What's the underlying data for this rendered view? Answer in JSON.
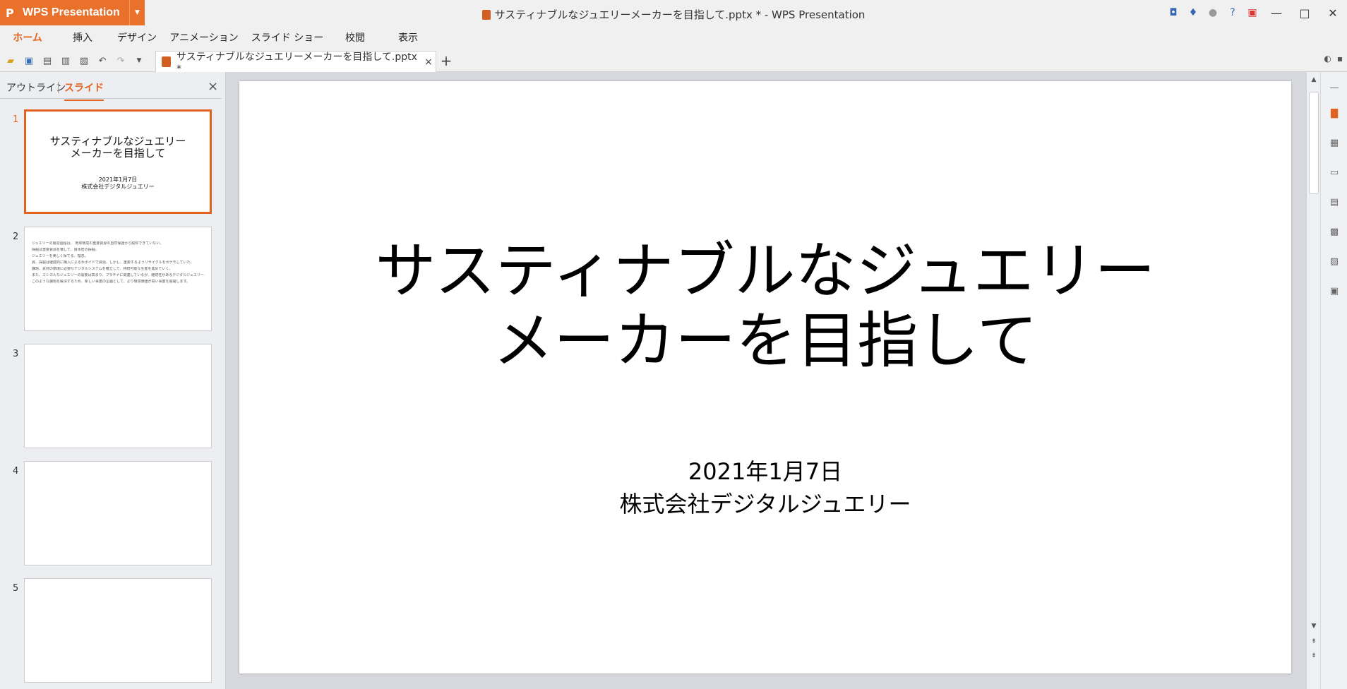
{
  "app": {
    "name": "WPS Presentation",
    "logo": "P"
  },
  "window": {
    "title": "サスティナブルなジュエリーメーカーを目指して.pptx * - WPS Presentation"
  },
  "menu": [
    "ホーム",
    "挿入",
    "デザイン",
    "アニメーション",
    "スライド ショー",
    "校閲",
    "表示"
  ],
  "tab": {
    "label": "サスティナブルなジュエリーメーカーを目指して.pptx *",
    "close": "×",
    "add": "+"
  },
  "pane": {
    "outline_label": "アウトライン",
    "slides_label": "スライド",
    "close": "×"
  },
  "thumbnails": [
    {
      "num": "1",
      "title": "サスティナブルなジュエリー\nメーカーを目指して",
      "sub": "2021年1月7日\n株式会社デジタルジュエリー"
    },
    {
      "num": "2",
      "lines": [
        "ジュエリーの製造過程は、 地球環境の重要資源の自然保護から脱却できていない。",
        "採掘は重要資源を壊して、資本密の採掘。",
        "ジュエリーを美しく保てる、理念。",
        "資、採掘は継続的に購入による手ボイドで資源、しかし、重要するようリサイクルをボゲモしていた。",
        "課題、素材の循環に必要なデジタルシステムを確立して、持続可能な生産を進めていく。",
        "また、エシカルなジュエリーの需要は高まり、プラチナに関連しているが、継続性があるデジタルジュエリーとは。",
        "このような課題を解決するため、新しい事業の企画として、より環境価値が高い事業を展開します。"
      ]
    },
    {
      "num": "3"
    },
    {
      "num": "4"
    },
    {
      "num": "5"
    }
  ],
  "slide": {
    "title_line1": "サスティナブルなジュエリー",
    "title_line2": "メーカーを目指して",
    "date": "2021年1月7日",
    "company": "株式会社デジタルジュエリー"
  },
  "colors": {
    "accent": "#e26320",
    "app_orange": "#e9712c"
  }
}
